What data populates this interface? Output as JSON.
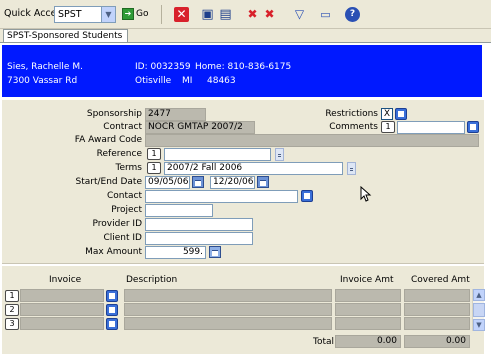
{
  "toolbar": {
    "quick_access_label": "Quick Access",
    "quick_access_value": "SPST",
    "go_label": "Go",
    "icons": [
      "delete-icon",
      "save-icon",
      "save-as-icon",
      "remove-icon",
      "remove-all-icon",
      "filter-icon",
      "window-icon",
      "help-icon"
    ]
  },
  "tab": {
    "label": "SPST-Sponsored Students"
  },
  "banner": {
    "name": "Sies, Rachelle M.",
    "address": "7300 Vassar Rd",
    "id_line": "ID: 0032359",
    "home_line": "Home: 810-836-6175",
    "city": "Otisville",
    "state": "MI",
    "zip": "48463"
  },
  "form": {
    "sponsorship": {
      "label": "Sponsorship",
      "value": "2477"
    },
    "contract": {
      "label": "Contract",
      "value": "NOCR GMTAP 2007/2"
    },
    "fa_award_code": {
      "label": "FA Award Code",
      "value": ""
    },
    "reference": {
      "label": "Reference",
      "count": "1",
      "value": ""
    },
    "terms": {
      "label": "Terms",
      "count": "1",
      "value": "2007/2  Fall 2006"
    },
    "start_end_date": {
      "label": "Start/End Date",
      "start": "09/05/06",
      "end": "12/20/06"
    },
    "contact": {
      "label": "Contact",
      "value": ""
    },
    "project": {
      "label": "Project",
      "value": ""
    },
    "provider_id": {
      "label": "Provider ID",
      "value": ""
    },
    "client_id": {
      "label": "Client ID",
      "value": ""
    },
    "max_amount": {
      "label": "Max Amount",
      "value": "599."
    },
    "restrictions": {
      "label": "Restrictions",
      "value": "X"
    },
    "comments": {
      "label": "Comments",
      "count": "1",
      "value": ""
    }
  },
  "grid": {
    "headers": {
      "invoice": "Invoice",
      "description": "Description",
      "invoice_amt": "Invoice Amt",
      "covered_amt": "Covered Amt"
    },
    "rows": [
      {
        "n": "1"
      },
      {
        "n": "2"
      },
      {
        "n": "3"
      }
    ],
    "total_label": "Total",
    "total_invoice": "0.00",
    "total_covered": "0.00"
  }
}
